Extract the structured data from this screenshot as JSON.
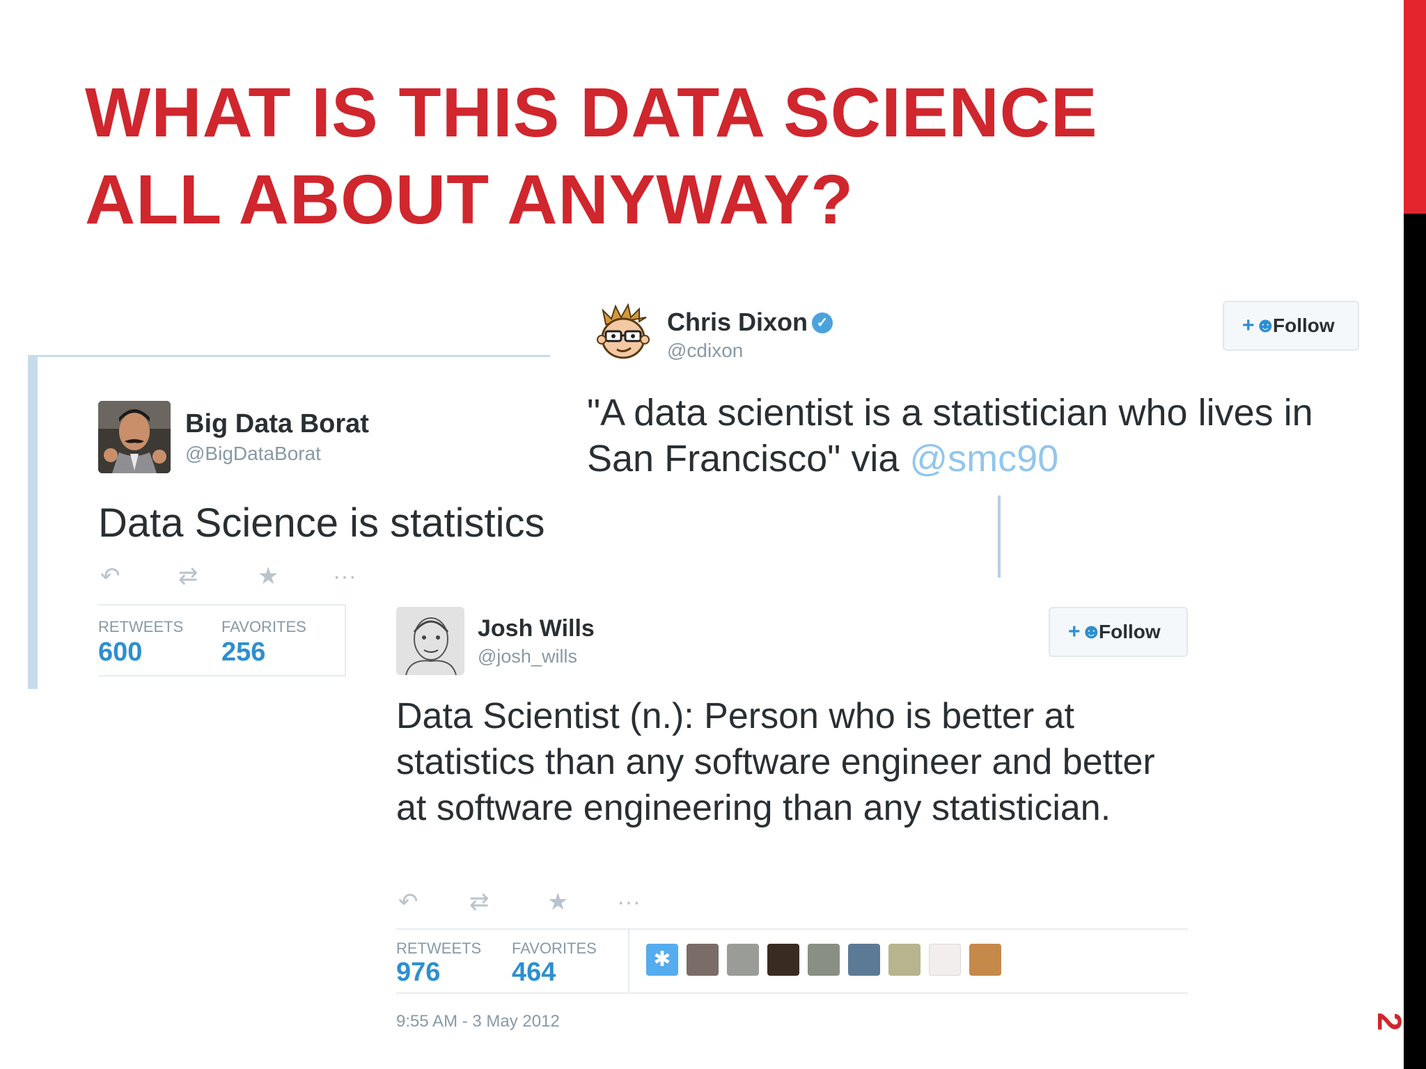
{
  "slide": {
    "title_line1": "WHAT IS THIS DATA SCIENCE",
    "title_line2": "ALL ABOUT ANYWAY?",
    "page_number": "2",
    "accent_color": "#d0262d"
  },
  "tweets": {
    "borat": {
      "name": "Big Data Borat",
      "handle": "@BigDataBorat",
      "text": "Data Science is statistics on a Mac.",
      "retweets_label": "RETWEETS",
      "retweets": "600",
      "favorites_label": "FAVORITES",
      "favorites": "256"
    },
    "chris": {
      "name": "Chris Dixon",
      "handle": "@cdixon",
      "text": "\"A data scientist is a statistician who lives in San Francisco\"  via ",
      "mention": "@smc90",
      "follow_label": "Follow"
    },
    "josh": {
      "name": "Josh Wills",
      "handle": "@josh_wills",
      "text": "Data Scientist (n.): Person who is better at statistics than any software engineer and better at software engineering than any statistician.",
      "retweets_label": "RETWEETS",
      "retweets": "976",
      "favorites_label": "FAVORITES",
      "favorites": "464",
      "timestamp": "9:55 AM - 3 May 2012",
      "follow_label": "Follow"
    }
  },
  "icons": {
    "reply": "reply-icon",
    "retweet": "retweet-icon",
    "favorite": "star-icon",
    "more": "more-icon",
    "follow": "add-user-icon",
    "verified": "verified-badge-icon"
  }
}
